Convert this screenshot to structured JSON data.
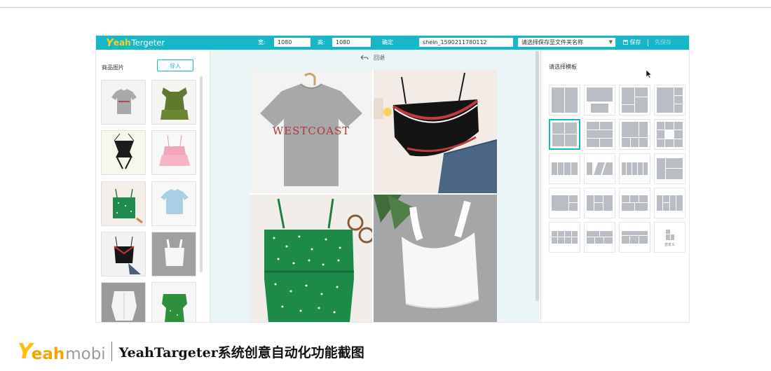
{
  "app": {
    "logo_mark": "Y",
    "logo_accent": "eah",
    "logo_rest": "Tergeter"
  },
  "toolbar": {
    "width_label": "宽:",
    "width_value": "1080",
    "height_label": "高:",
    "height_value": "1080",
    "confirm_label": "确定",
    "filename_value": "shein_1590211780112",
    "folder_select_placeholder": "请选择保存至文件夹名称",
    "save_label": "保存",
    "faded_label": "先保存"
  },
  "left_panel": {
    "title": "商品图片",
    "import_label": "导入",
    "thumbnails": [
      "grey-tshirt",
      "green-ruffle-top",
      "black-lace-up-top",
      "pink-tiered-cami",
      "green-floral-tube-top",
      "blue-ribbed-tee",
      "black-stripe-cami",
      "white-tank-top",
      "white-button-blouse",
      "green-ruffle-top-2"
    ]
  },
  "canvas": {
    "undo_label": "回退",
    "collage": [
      {
        "item": "grey-tshirt",
        "print": "WESTCOAST"
      },
      {
        "item": "black-stripe-cami"
      },
      {
        "item": "green-floral-cami"
      },
      {
        "item": "white-tank-top"
      }
    ]
  },
  "right_panel": {
    "title": "请选择模板",
    "templates": [
      "split-2-vertical",
      "top-bottom-banner",
      "grid-uneven-1",
      "grid-uneven-2",
      "grid-2x2",
      "grid-3-rows",
      "grid-mixed-1",
      "grid-checker",
      "row-4",
      "row-slant",
      "row-5",
      "grid-mixed-2",
      "grid-row-mix-1",
      "grid-row-mix-2",
      "grid-row-mix-3",
      "grid-row-mix-4",
      "grid-3x4-a",
      "grid-3x4-b",
      "grid-3x4-c",
      "custom"
    ],
    "selected_index": 4,
    "custom_label": "自定义"
  },
  "footer": {
    "logo_mark": "Y",
    "logo_accent": "eah",
    "logo_rest": "mobi",
    "caption": "YeahTargeter系统创意自动化功能截图"
  },
  "colors": {
    "accent": "#16b7c8",
    "logo_yellow": "#ffcc1a",
    "canvas_bg": "#eaf5f7"
  }
}
